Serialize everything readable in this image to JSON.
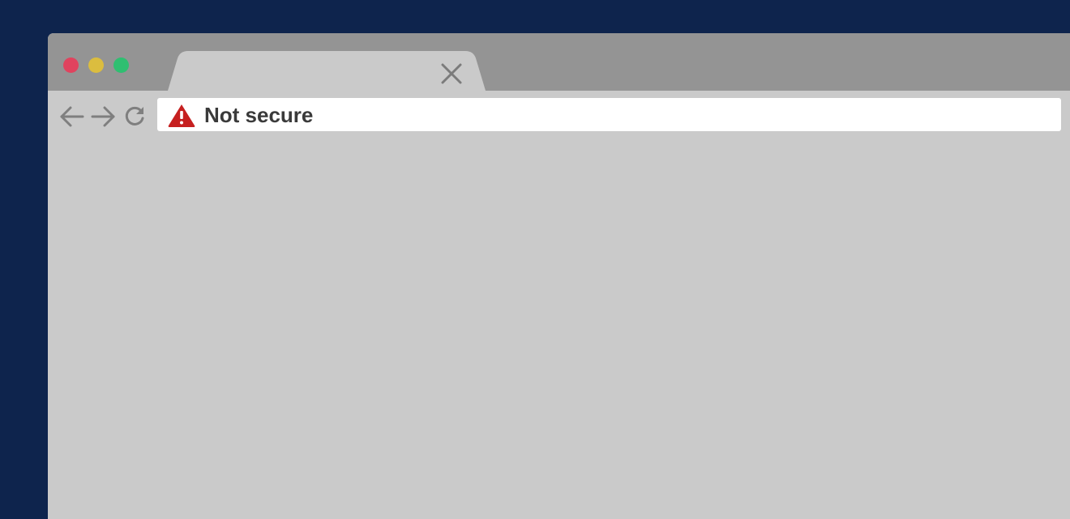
{
  "address_bar": {
    "security_label": "Not secure",
    "security_icon": "warning-triangle-icon"
  },
  "tab": {
    "title": "",
    "close_icon": "close-icon"
  },
  "navigation": {
    "back_icon": "arrow-left-icon",
    "forward_icon": "arrow-right-icon",
    "reload_icon": "reload-icon"
  },
  "colors": {
    "desktop_background": "#0e244d",
    "titlebar": "#949494",
    "chrome": "#cacaca",
    "traffic_close": "#e0435e",
    "traffic_minimize": "#dbbd3f",
    "traffic_maximize": "#2fbf71",
    "warning": "#c62020"
  }
}
